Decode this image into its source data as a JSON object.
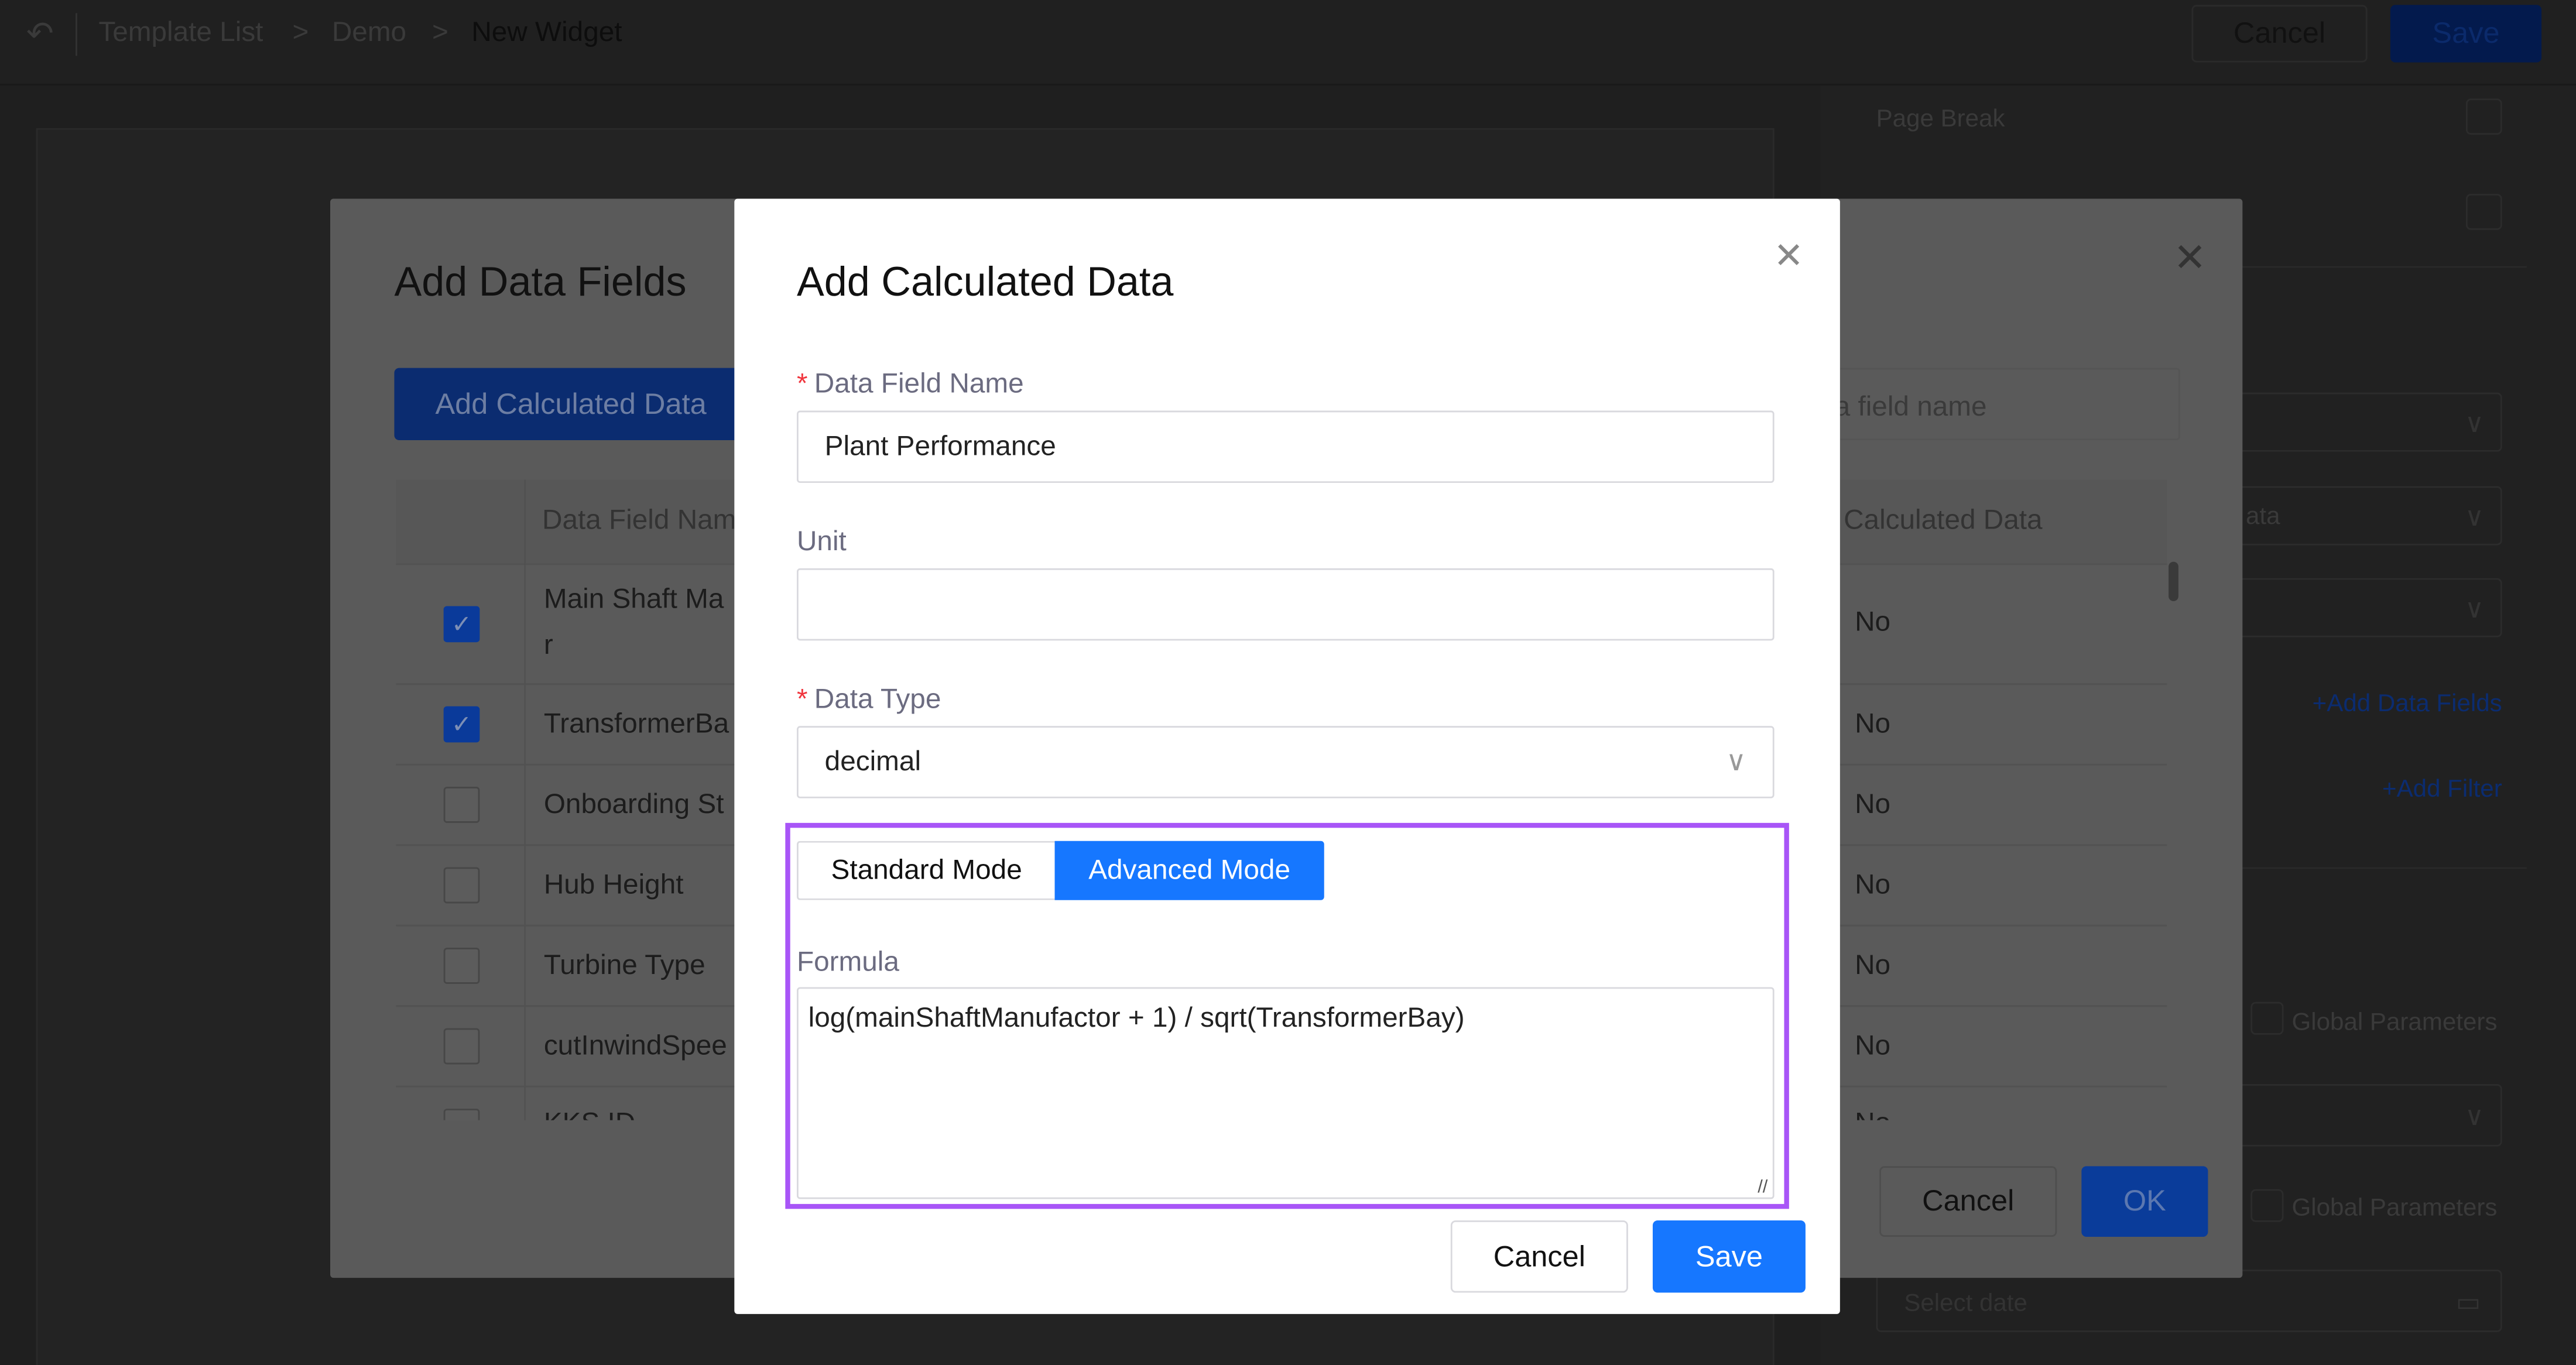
{
  "header": {
    "breadcrumb": [
      "Template List",
      "Demo",
      "New Widget"
    ],
    "cancel": "Cancel",
    "save": "Save"
  },
  "right_panel": {
    "page_break": "Page Break",
    "placeholder_select": "ata",
    "add_data_fields": "+Add Data Fields",
    "add_filter": "+Add Filter",
    "global_params_1": "Global Parameters",
    "global_params_2": "Global Parameters",
    "date_placeholder": "Select date"
  },
  "data_fields_modal": {
    "title": "Add Data Fields",
    "add_calc_button": "Add Calculated Data",
    "search_placeholder": "ta field name",
    "columns": [
      "Data Field Name",
      "s Calculated Data"
    ],
    "rows": [
      {
        "name": "Main Shaft Ma",
        "name2": "r",
        "checked": true,
        "calc": "No"
      },
      {
        "name": "TransformerBa",
        "checked": true,
        "calc": "No"
      },
      {
        "name": "Onboarding St",
        "checked": false,
        "calc": "No"
      },
      {
        "name": "Hub Height",
        "checked": false,
        "calc": "No"
      },
      {
        "name": "Turbine Type",
        "checked": false,
        "calc": "No"
      },
      {
        "name": "cutInwindSpee",
        "checked": false,
        "calc": "No"
      },
      {
        "name": "KKS ID",
        "checked": false,
        "calc": "No"
      }
    ],
    "cancel": "Cancel",
    "ok": "OK"
  },
  "calc_modal": {
    "title": "Add Calculated Data",
    "field_name_label": "Data Field Name",
    "field_name_value": "Plant Performance",
    "unit_label": "Unit",
    "unit_value": "",
    "data_type_label": "Data Type",
    "data_type_value": "decimal",
    "mode_tabs": [
      {
        "label": "Standard Mode",
        "active": false
      },
      {
        "label": "Advanced Mode",
        "active": true
      }
    ],
    "formula_label": "Formula",
    "formula_value": "log(mainShaftManufactor + 1) / sqrt(TransformerBay)",
    "cancel": "Cancel",
    "save": "Save"
  },
  "colors": {
    "primary": "#1677ff",
    "highlight_border": "#a855f7",
    "required": "#f0353d"
  }
}
